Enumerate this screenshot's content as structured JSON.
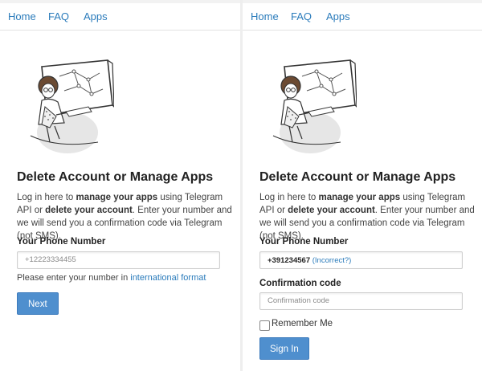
{
  "nav": {
    "home": "Home",
    "faq": "FAQ",
    "apps": "Apps"
  },
  "title": "Delete Account or Manage Apps",
  "description": {
    "part1": "Log in here to ",
    "bold1": "manage your apps",
    "part2": " using Telegram API or ",
    "bold2": "delete your account",
    "part3": ". Enter your number and we will send you a confirmation code via Telegram (not SMS)."
  },
  "phone_label": "Your Phone Number",
  "left_panel": {
    "phone_placeholder": "+12223334455",
    "hint_text": "Please enter your number in ",
    "hint_link": "international format",
    "next_button": "Next"
  },
  "right_panel": {
    "phone_value": "+391234567",
    "incorrect_link": "(Incorrect?)",
    "code_label": "Confirmation code",
    "code_placeholder": "Confirmation code",
    "remember_label": "Remember Me",
    "sign_in_button": "Sign In"
  },
  "colors": {
    "link": "#2a7bbb",
    "button": "#4f8fce"
  },
  "icons": {
    "illustration": "telegram-user-at-desk-illustration"
  }
}
